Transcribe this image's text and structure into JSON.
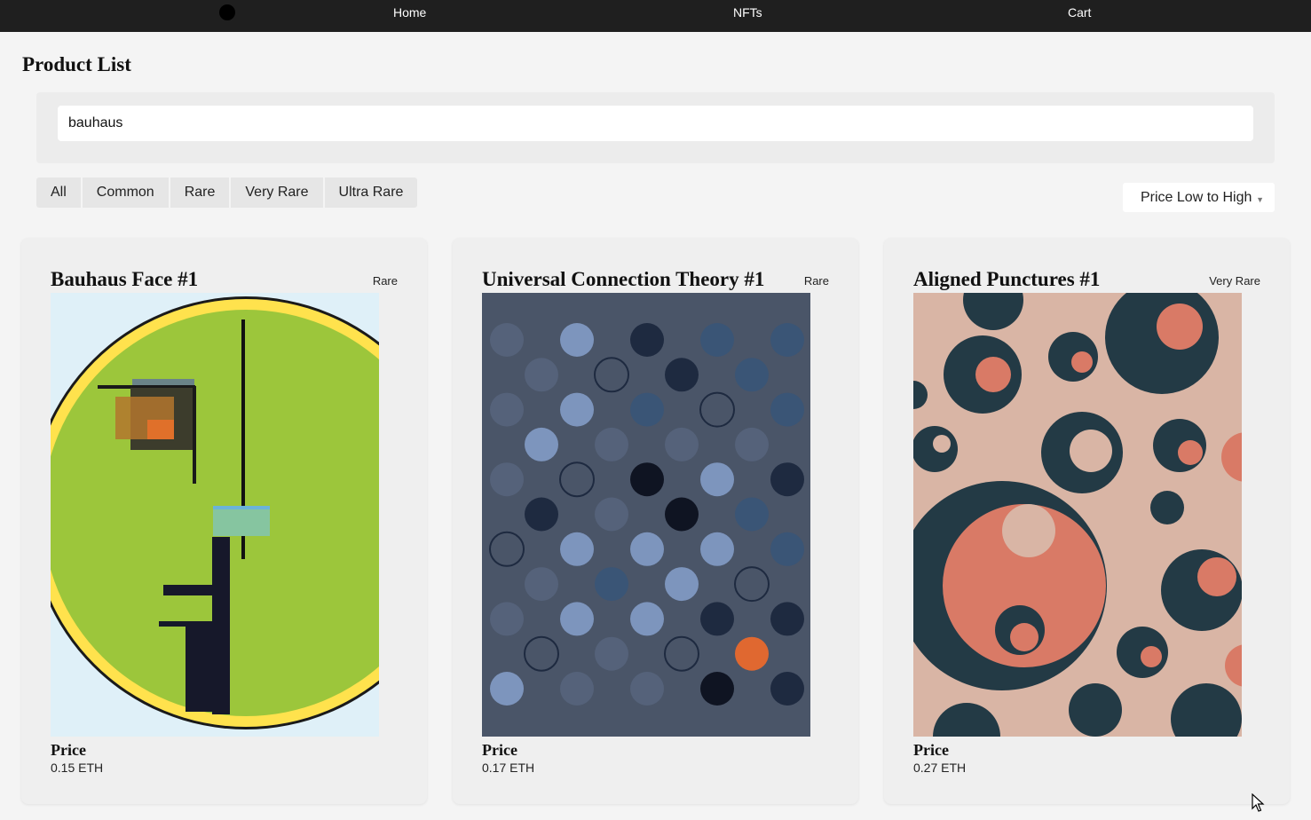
{
  "nav": {
    "links": [
      "Home",
      "NFTs",
      "Cart"
    ]
  },
  "page": {
    "title": "Product List"
  },
  "search": {
    "value": "bauhaus"
  },
  "filters": [
    "All",
    "Common",
    "Rare",
    "Very Rare",
    "Ultra Rare"
  ],
  "sort": {
    "selected": "Price Low to High"
  },
  "products": [
    {
      "title": "Bauhaus Face #1",
      "rarity": "Rare",
      "price_label": "Price",
      "price": "0.15 ETH"
    },
    {
      "title": "Universal Connection Theory #1",
      "rarity": "Rare",
      "price_label": "Price",
      "price": "0.17 ETH"
    },
    {
      "title": "Aligned Punctures #1",
      "rarity": "Very Rare",
      "price_label": "Price",
      "price": "0.27 ETH"
    }
  ],
  "colors": {
    "nav_bg": "#1f1f1f",
    "page_bg": "#f4f4f4",
    "card_bg": "#efefef"
  }
}
